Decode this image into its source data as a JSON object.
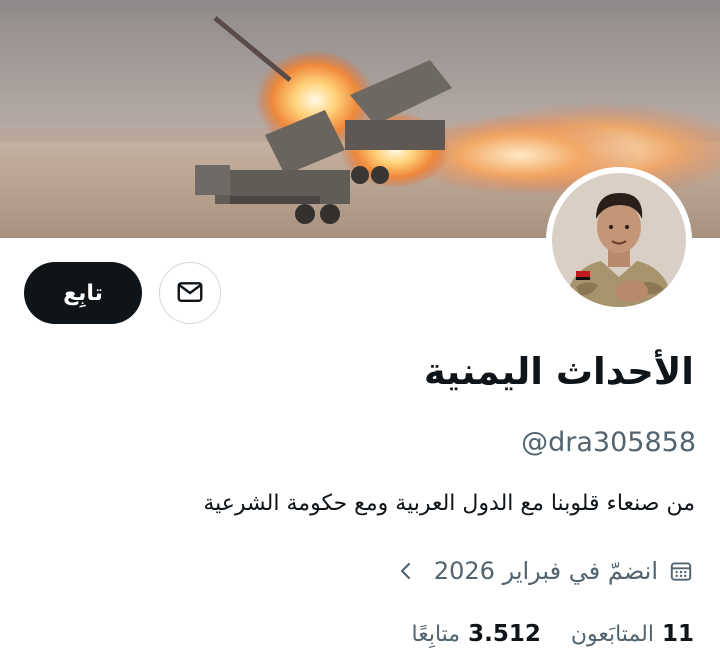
{
  "profile": {
    "display_name": "الأحداث اليمنية",
    "handle": "@dra305858",
    "bio": "من صنعاء قلوبنا مع الدول العربية ومع حكومة الشرعية",
    "joined": "انضمّ في فبراير 2026"
  },
  "actions": {
    "follow_label": "تابِع",
    "message_icon": "envelope-icon"
  },
  "stats": {
    "followers_count": "11",
    "followers_label": "المتابَعون",
    "following_count": "3.512",
    "following_label": "متابِعًا"
  },
  "icons": {
    "joined": "calendar-icon",
    "more": "chevron-left-icon"
  },
  "colors": {
    "text_primary": "#0f1419",
    "text_secondary": "#536471",
    "button_dark": "#0f1419",
    "border": "#cfd9de"
  }
}
